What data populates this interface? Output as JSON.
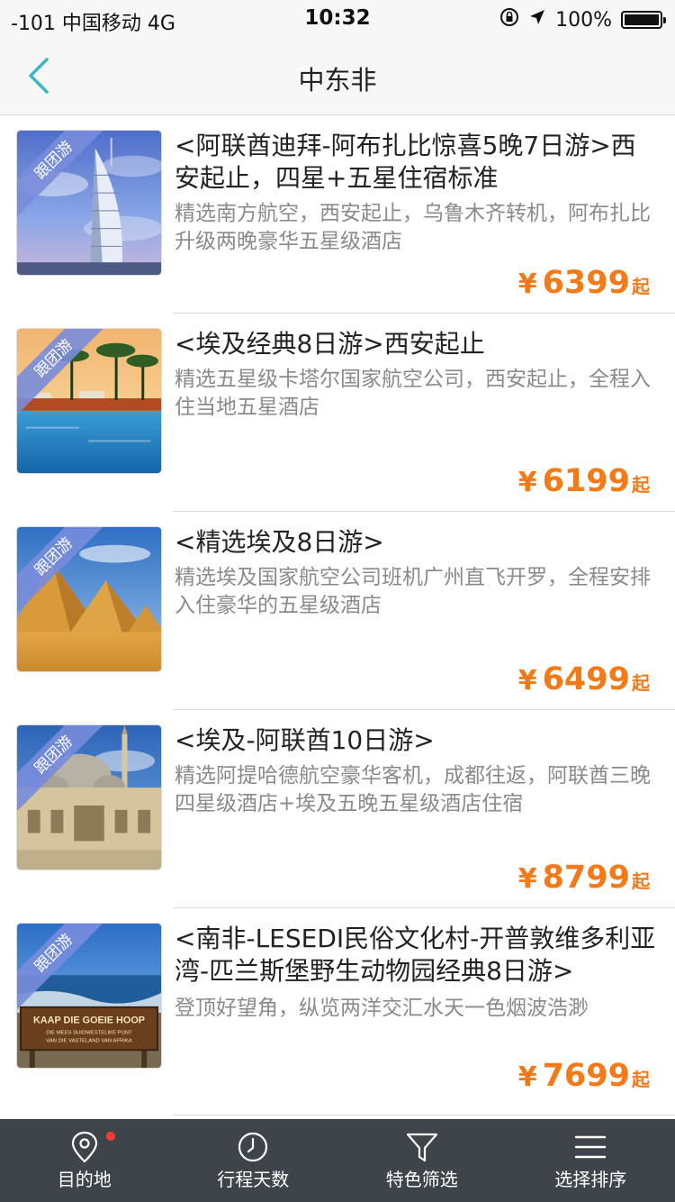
{
  "status_bar": {
    "carrier": "-101 中国移动   4G",
    "time": "10:32",
    "battery": "100%"
  },
  "nav": {
    "title": "中东非"
  },
  "items": [
    {
      "badge": "跟团游",
      "title": "<阿联酋迪拜-阿布扎比惊喜5晚7日游>西安起止，四星+五星住宿标准",
      "desc": "精选南方航空，西安起止，乌鲁木齐转机，阿布扎比升级两晚豪华五星级酒店",
      "currency": "¥",
      "price": "6399",
      "price_suffix": "起",
      "image": "burj-al-arab-photo"
    },
    {
      "badge": "跟团游",
      "title": "<埃及经典8日游>西安起止",
      "desc": "精选五星级卡塔尔国家航空公司，西安起止，全程入住当地五星酒店",
      "currency": "¥",
      "price": "6199",
      "price_suffix": "起",
      "image": "resort-pool-palms-photo"
    },
    {
      "badge": "跟团游",
      "title": "<精选埃及8日游>",
      "desc": "精选埃及国家航空公司班机广州直飞开罗，全程安排入住豪华的五星级酒店",
      "currency": "¥",
      "price": "6499",
      "price_suffix": "起",
      "image": "pyramids-photo"
    },
    {
      "badge": "跟团游",
      "title": "<埃及-阿联酋10日游>",
      "desc": "精选阿提哈德航空豪华客机，成都往返，阿联酋三晚四星级酒店+埃及五晚五星级酒店住宿",
      "currency": "¥",
      "price": "8799",
      "price_suffix": "起",
      "image": "mosque-photo"
    },
    {
      "badge": "跟团游",
      "title": "<南非-LESEDI民俗文化村-开普敦维多利亚湾-匹兰斯堡野生动物园经典8日游>",
      "desc": "登顶好望角，纵览两洋交汇水天一色烟波浩渺",
      "currency": "¥",
      "price": "7699",
      "price_suffix": "起",
      "image": "cape-of-good-hope-sign-photo",
      "sign_text": [
        "KAAP DIE GOEIE HOOP",
        "DIE MEES SUIDWESTELIKE PUNT",
        "VAN DIE VASTELAND VAN AFRIKA"
      ]
    }
  ],
  "tab_bar": {
    "tabs": [
      {
        "label": "目的地",
        "icon": "location-pin-icon"
      },
      {
        "label": "行程天数",
        "icon": "clock-icon"
      },
      {
        "label": "特色筛选",
        "icon": "filter-funnel-icon"
      },
      {
        "label": "选择排序",
        "icon": "menu-lines-icon"
      }
    ]
  },
  "colors": {
    "price": "#f47a17",
    "accent": "#3bb7c4",
    "tab_bar_bg": "#3f444b",
    "badge": "#7d8fdc"
  }
}
